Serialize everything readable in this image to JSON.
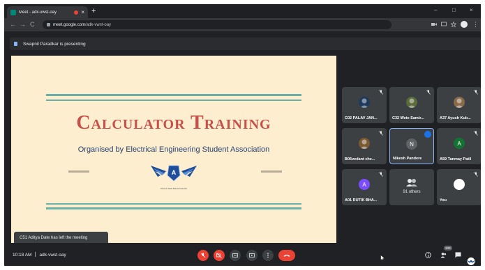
{
  "browser": {
    "tab_title": "Meet - adk-vwst-oay",
    "new_tab_symbol": "+",
    "close_tab_symbol": "×",
    "minimize_symbol": "–",
    "maximize_symbol": "□",
    "close_window_symbol": "×",
    "url_domain": "meet.google.com",
    "url_path": "/adk-vwst-oay"
  },
  "presenter_bar": {
    "text": "Swapnil Paradkar is presenting"
  },
  "slide": {
    "title": "Calculator Training",
    "subtitle": "Organised by Electrical Engineering Student Association",
    "motto": "Where Skill Meets Dreams"
  },
  "participants": [
    {
      "name": "C02 PALAV JAN...",
      "avatar": "photo",
      "avatar_color": "#1e3a5c",
      "muted": true,
      "speaking": false
    },
    {
      "name": "C32 Wete Samir...",
      "avatar": "photo",
      "avatar_color": "#5a6b3c",
      "muted": true,
      "speaking": false
    },
    {
      "name": "A37 Ayush Kub...",
      "avatar": "photo",
      "avatar_color": "#8a6a4a",
      "muted": true,
      "speaking": false
    },
    {
      "name": "B06vedant che...",
      "avatar": "photo",
      "avatar_color": "#7a5a32",
      "muted": true,
      "speaking": false
    },
    {
      "name": "Nikesh Pandere",
      "avatar": "N",
      "avatar_color": "#5f6368",
      "muted": false,
      "speaking": true
    },
    {
      "name": "A59 Tanmay Patil",
      "avatar": "A",
      "avatar_color": "#137333",
      "muted": true,
      "speaking": false
    },
    {
      "name": "A01 RUTIK BHA...",
      "avatar": "A",
      "avatar_color": "#7c4dff",
      "muted": true,
      "speaking": false
    },
    {
      "name": "91 others",
      "avatar": "group",
      "avatar_color": "#5f6368",
      "muted": false,
      "speaking": false
    },
    {
      "name": "You",
      "avatar": "photo",
      "avatar_color": "#ffffff",
      "muted": true,
      "speaking": false
    }
  ],
  "toast": {
    "text": "C51 Aditya Date has left the meeting"
  },
  "bottom_bar": {
    "time": "10:18 AM",
    "meeting_code": "adk-vwst-oay",
    "people_count": "100"
  },
  "colors": {
    "accent": "#1a73e8",
    "danger": "#ea4335",
    "slide_bg": "#fdeed0",
    "slide_title": "#c8504a",
    "slide_subtitle": "#27406a",
    "rule": "#66b0a8"
  }
}
